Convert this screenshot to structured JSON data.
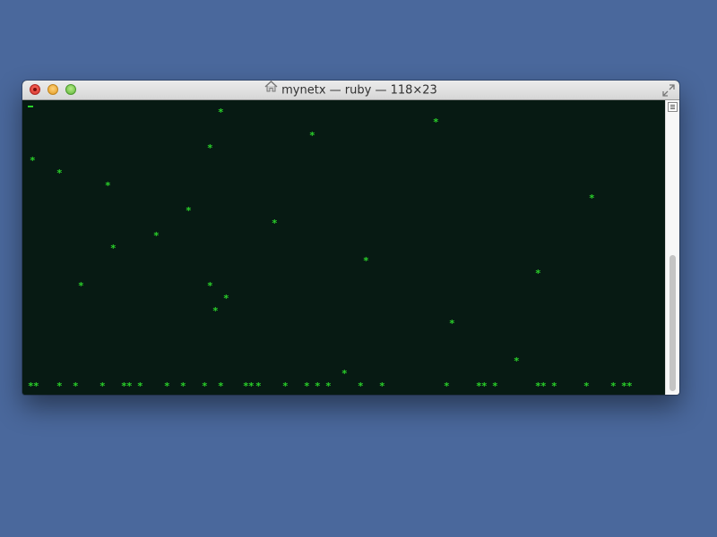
{
  "window": {
    "title": "mynetx — ruby — 118×23"
  },
  "terminal": {
    "flake_char": "*",
    "text_color": "#2ad12a",
    "background": "#071a13"
  }
}
